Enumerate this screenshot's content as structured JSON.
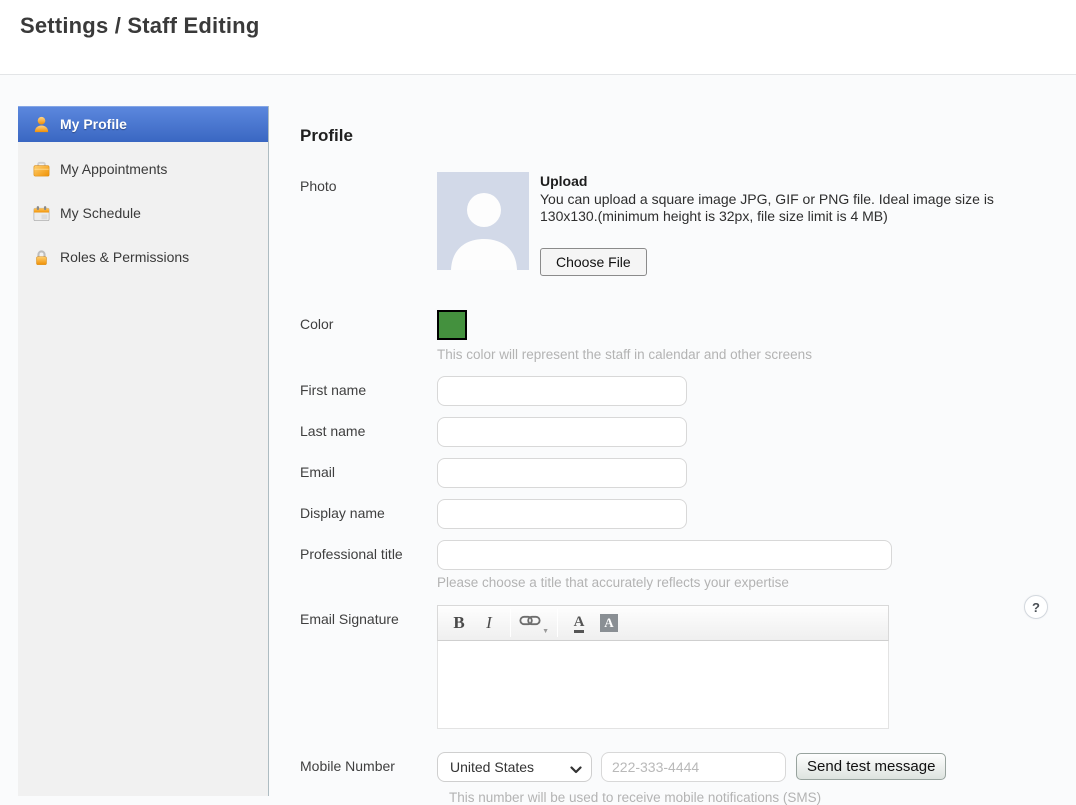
{
  "header": {
    "title": "Settings / Staff Editing"
  },
  "sidebar": {
    "active_color": "#4a76cf",
    "items": [
      {
        "label": "My Profile",
        "icon": "person-icon",
        "active": true
      },
      {
        "label": "My Appointments",
        "icon": "briefcase-icon",
        "active": false
      },
      {
        "label": "My Schedule",
        "icon": "calendar-icon",
        "active": false
      },
      {
        "label": "Roles & Permissions",
        "icon": "lock-icon",
        "active": false
      }
    ]
  },
  "main": {
    "heading": "Profile",
    "photo": {
      "label": "Photo",
      "upload_title": "Upload",
      "upload_desc": "You can upload a square image JPG, GIF or PNG file. Ideal image size is 130x130.(minimum height is 32px, file size limit is 4 MB)",
      "choose_file_label": "Choose File"
    },
    "color": {
      "label": "Color",
      "value": "#44913e",
      "hint": "This color will represent the staff in calendar and other screens"
    },
    "fields": [
      {
        "label": "First name",
        "value": ""
      },
      {
        "label": "Last name",
        "value": ""
      },
      {
        "label": "Email",
        "value": ""
      },
      {
        "label": "Display name",
        "value": ""
      }
    ],
    "professional_title": {
      "label": "Professional title",
      "value": "",
      "hint": "Please choose a title that accurately reflects your expertise"
    },
    "email_signature": {
      "label": "Email Signature",
      "bold": "B",
      "italic": "I",
      "font_color": "A",
      "background_color": "A",
      "value": ""
    },
    "help_label": "?",
    "mobile": {
      "label": "Mobile Number",
      "country": "United States",
      "phone_placeholder": "222-333-4444",
      "send_button_label": "Send test message",
      "hint": "This number will be used to receive mobile notifications (SMS)"
    }
  }
}
